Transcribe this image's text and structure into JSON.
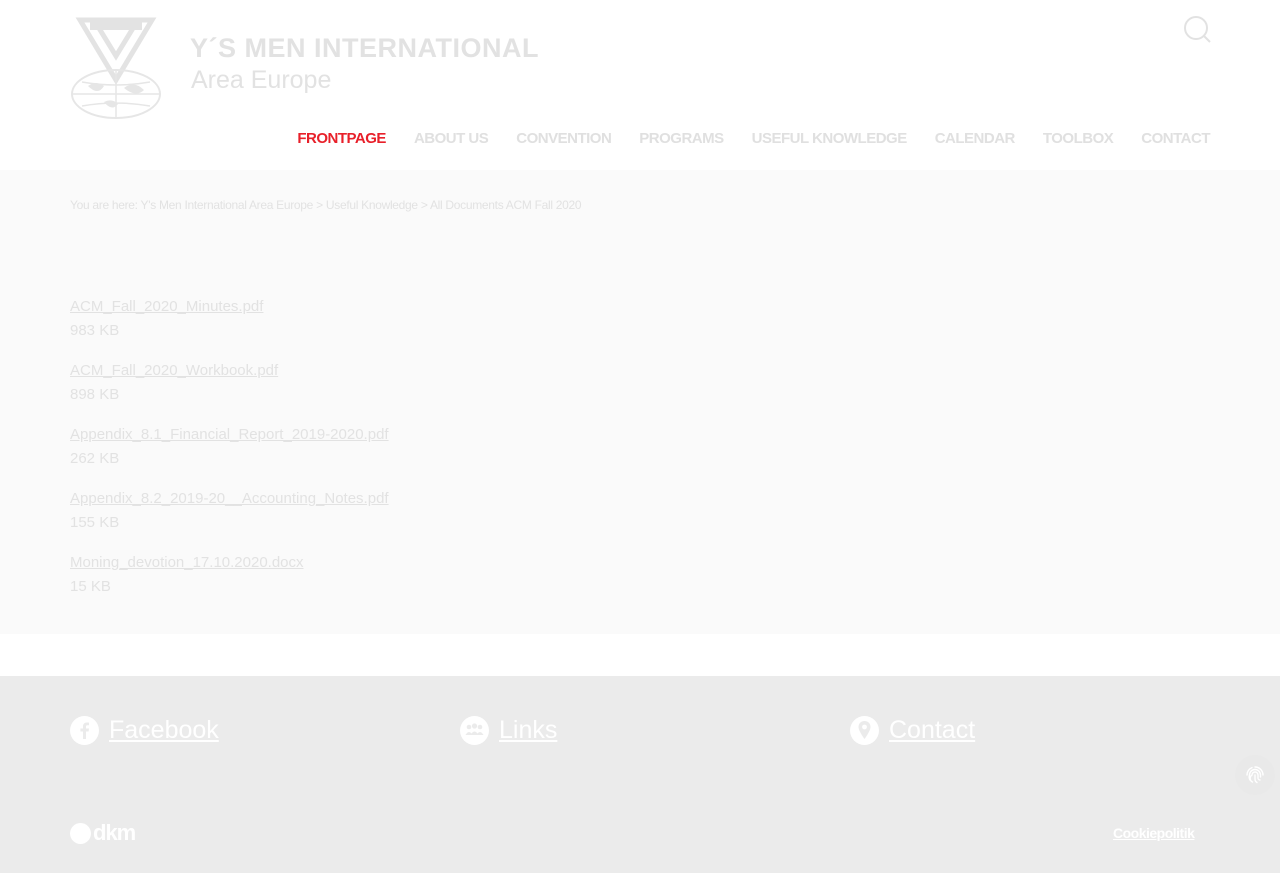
{
  "header": {
    "logo_icon": "ys-men-globe-logo",
    "brand_title": "Y´S MEN INTERNATIONAL",
    "brand_subtitle": "Area Europe",
    "search_icon": "search-icon"
  },
  "nav": {
    "items": [
      {
        "label": "FRONTPAGE",
        "active": true
      },
      {
        "label": "ABOUT US"
      },
      {
        "label": "CONVENTION"
      },
      {
        "label": "PROGRAMS"
      },
      {
        "label": "USEFUL KNOWLEDGE"
      },
      {
        "label": "CALENDAR"
      },
      {
        "label": "TOOLBOX"
      },
      {
        "label": "CONTACT"
      }
    ],
    "active_color": "#e8202a"
  },
  "breadcrumb": {
    "prefix": "You are here:",
    "items": [
      "Y's Men International Area Europe",
      "Useful Knowledge",
      "All Documents ACM Fall 2020"
    ],
    "separator": ">"
  },
  "documents": [
    {
      "name": "ACM_Fall_2020_Minutes.pdf",
      "size": "983 KB"
    },
    {
      "name": "ACM_Fall_2020_Workbook.pdf",
      "size": "898 KB"
    },
    {
      "name": "Appendix_8.1_Financial_Report_2019-2020.pdf",
      "size": "262 KB"
    },
    {
      "name": "Appendix_8.2_2019-20__Accounting_Notes.pdf",
      "size": "155 KB"
    },
    {
      "name": "Moning_devotion_17.10.2020.docx",
      "size": "15 KB"
    }
  ],
  "footer": {
    "links": [
      {
        "label": "Facebook",
        "icon": "facebook-icon"
      },
      {
        "label": "Links",
        "icon": "people-group-icon"
      },
      {
        "label": "Contact",
        "icon": "map-pin-icon"
      }
    ],
    "dkm_logo": "dkm",
    "cookie_label": "Cookiepolitik",
    "fingerprint_icon": "fingerprint-icon"
  },
  "colors": {
    "main_bg": "#fafafa",
    "footer_bg": "#ebebeb",
    "muted_text": "#e2e2e2"
  }
}
